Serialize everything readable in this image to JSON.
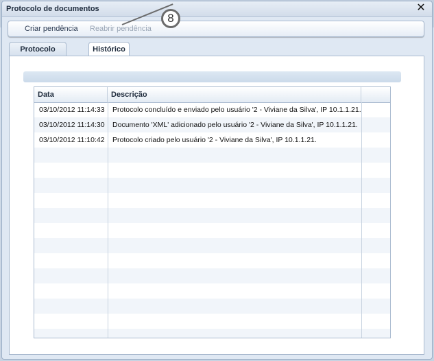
{
  "dialog": {
    "title": "Protocolo de documentos"
  },
  "toolbar": {
    "create_label": "Criar pendência",
    "reopen_label": "Reabrir pendência"
  },
  "callout": {
    "number": "8"
  },
  "tabs": [
    {
      "label": "Protocolo",
      "active": false
    },
    {
      "label": "Histórico",
      "active": true
    }
  ],
  "table": {
    "columns": [
      "Data",
      "Descrição"
    ],
    "rows": [
      {
        "data": "03/10/2012 11:14:33",
        "descricao": "Protocolo concluído e enviado pelo usuário '2 - Viviane da Silva', IP 10.1.1.21."
      },
      {
        "data": "03/10/2012 11:14:30",
        "descricao": "Documento 'XML' adicionado pelo usuário '2 - Viviane da Silva', IP 10.1.1.21."
      },
      {
        "data": "03/10/2012 11:10:42",
        "descricao": "Protocolo criado pelo usuário '2 - Viviane da Silva', IP 10.1.1.21."
      }
    ]
  }
}
